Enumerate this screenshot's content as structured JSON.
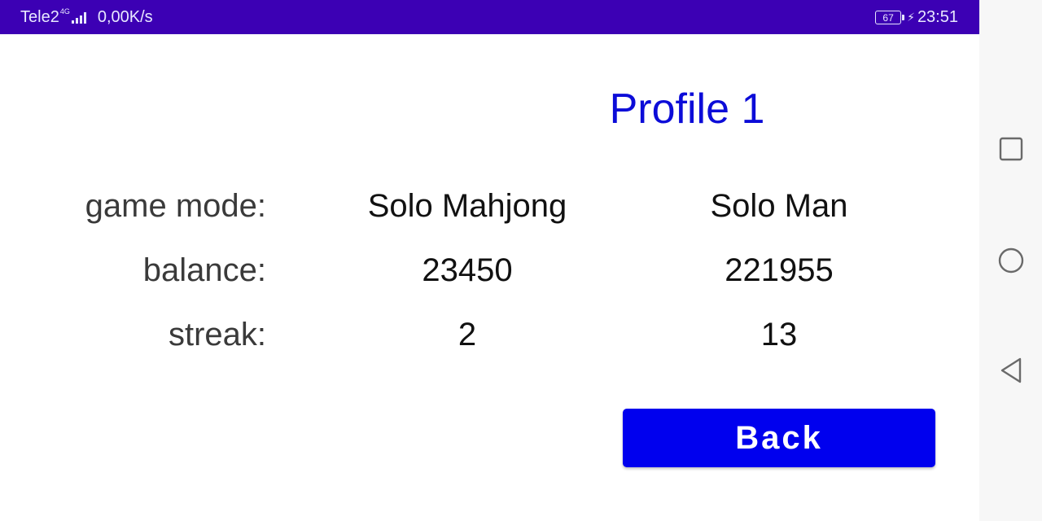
{
  "status_bar": {
    "carrier": "Tele2",
    "network_type": "4G",
    "speed": "0,00K/s",
    "battery": "67",
    "time": "23:51",
    "bg_color": "#3c00b4"
  },
  "profile": {
    "title": "Profile 1"
  },
  "stats": {
    "labels": {
      "game_mode": "game mode:",
      "balance": "balance:",
      "streak": "streak:"
    },
    "columns": [
      {
        "game_mode": "Solo Mahjong",
        "balance": "23450",
        "streak": "2"
      },
      {
        "game_mode": "Solo Man",
        "balance": "221955",
        "streak": "13"
      }
    ]
  },
  "actions": {
    "back_label": "Back",
    "accent_color": "#0000ee"
  },
  "nav_bar": {
    "icons": [
      "recent-apps-icon",
      "home-icon",
      "back-icon"
    ]
  }
}
